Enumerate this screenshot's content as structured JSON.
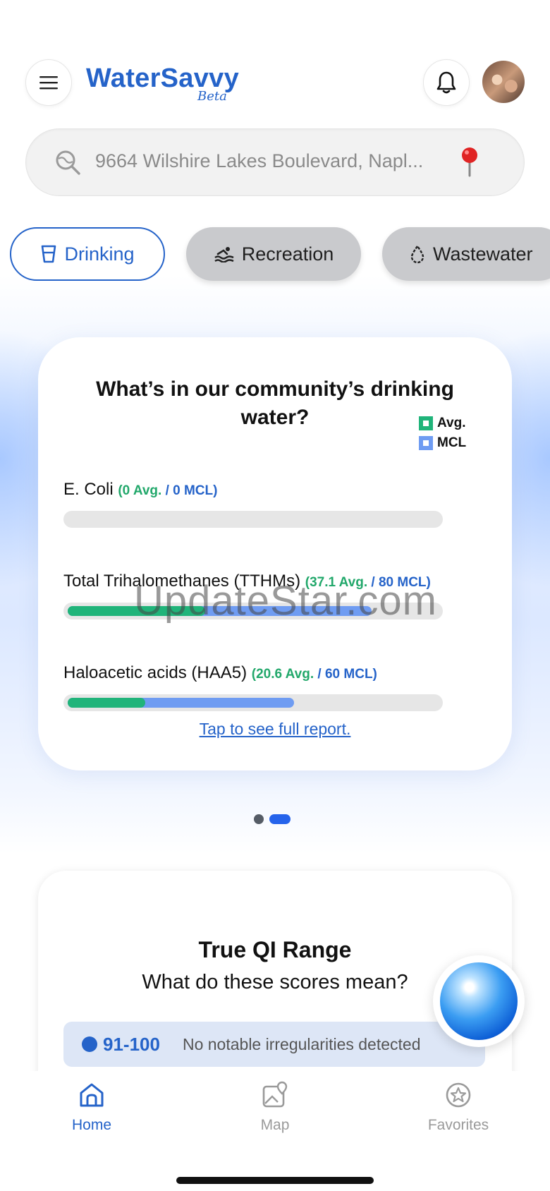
{
  "app": {
    "name": "WaterSavvy",
    "badge": "Beta"
  },
  "search": {
    "value": "9664 Wilshire Lakes Boulevard, Napl..."
  },
  "tabs": [
    {
      "label": "Drinking",
      "icon": "cup-icon",
      "active": true
    },
    {
      "label": "Recreation",
      "icon": "swimmer-icon",
      "active": false
    },
    {
      "label": "Wastewater",
      "icon": "drop-icon",
      "active": false
    }
  ],
  "contaminants_card": {
    "title": "What’s in our community’s drinking water?",
    "legend": {
      "avg": "Avg.",
      "mcl": "MCL"
    },
    "colors": {
      "avg": "#20b47a",
      "mcl": "#6f9cf2"
    },
    "items": [
      {
        "name": "E. Coli",
        "avg_text": "(0 Avg.",
        "mcl_text": " / 0 MCL)",
        "avg": 0,
        "mcl": 0,
        "avg_fraction": 0,
        "mcl_fraction": 0
      },
      {
        "name": "Total Trihalomethanes (TTHMs)",
        "avg_text": "(37.1 Avg.",
        "mcl_text": " / 80 MCL)",
        "avg": 37.1,
        "mcl": 80,
        "avg_fraction": 0.37,
        "mcl_fraction": 0.82
      },
      {
        "name": "Haloacetic acids (HAA5)",
        "avg_text": "(20.6 Avg.",
        "mcl_text": " / 60 MCL)",
        "avg": 20.6,
        "mcl": 60,
        "avg_fraction": 0.21,
        "mcl_fraction": 0.61
      }
    ],
    "link": "Tap to see full report."
  },
  "watermark": "UpdateStar.com",
  "pager": {
    "count": 2,
    "active_index": 1
  },
  "qi_card": {
    "title": "True QI Range",
    "subtitle": "What do these scores mean?",
    "ranges": [
      {
        "range": "91-100",
        "description": "No notable irregularities detected"
      }
    ]
  },
  "nav": [
    {
      "label": "Home",
      "icon": "home-icon",
      "active": true
    },
    {
      "label": "Map",
      "icon": "map-icon",
      "active": false
    },
    {
      "label": "Favorites",
      "icon": "star-icon",
      "active": false
    }
  ]
}
